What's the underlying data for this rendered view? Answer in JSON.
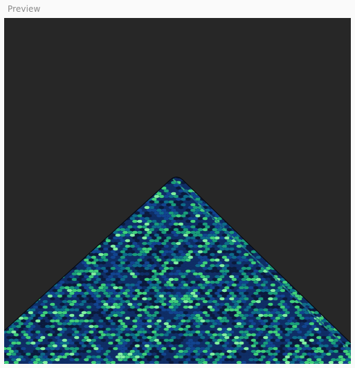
{
  "panel": {
    "title": "Preview"
  },
  "preview": {
    "background_color": "#272727",
    "palette": [
      "#0b1a3c",
      "#0f2e66",
      "#12448f",
      "#0d6b8a",
      "#1a9d7a",
      "#3fd07a",
      "#7ff0a0"
    ],
    "edge_color": "#000000",
    "content": "cellular-automaton-triangle"
  }
}
